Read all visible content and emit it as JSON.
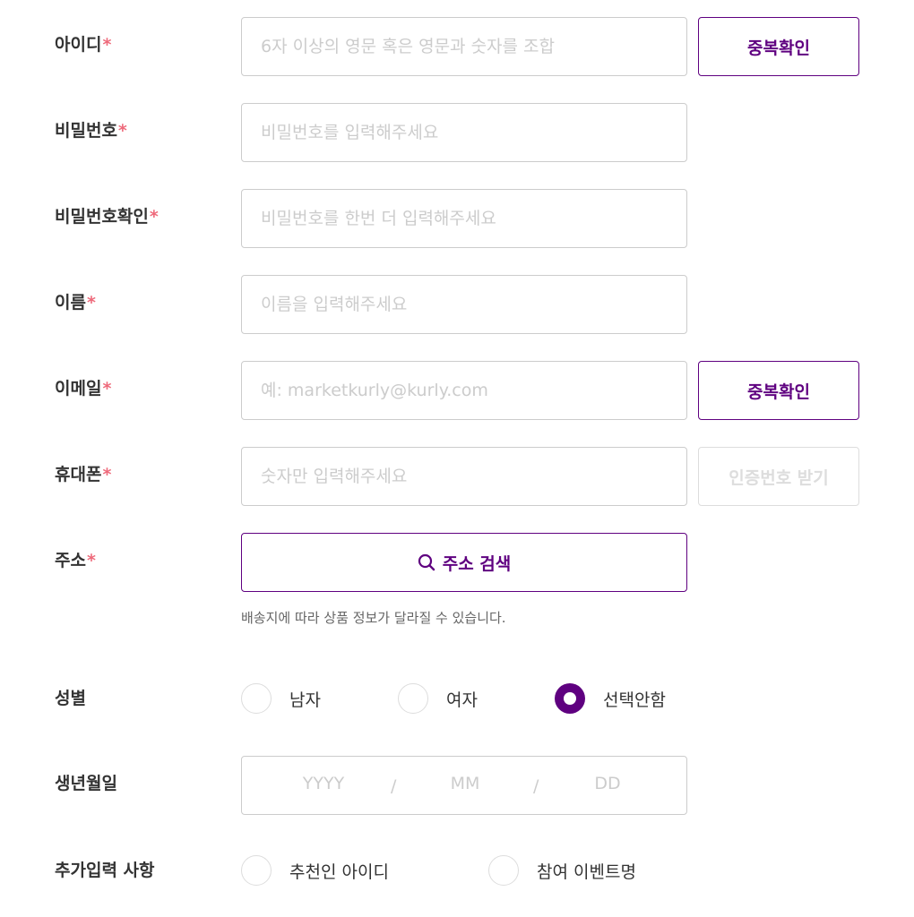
{
  "form": {
    "userid": {
      "label": "아이디",
      "required_mark": "*",
      "placeholder": "6자 이상의 영문 혹은 영문과 숫자를 조합",
      "check_button": "중복확인"
    },
    "password": {
      "label": "비밀번호",
      "required_mark": "*",
      "placeholder": "비밀번호를 입력해주세요"
    },
    "password_confirm": {
      "label": "비밀번호확인",
      "required_mark": "*",
      "placeholder": "비밀번호를 한번 더 입력해주세요"
    },
    "name": {
      "label": "이름",
      "required_mark": "*",
      "placeholder": "이름을 입력해주세요"
    },
    "email": {
      "label": "이메일",
      "required_mark": "*",
      "placeholder": "예: marketkurly@kurly.com",
      "check_button": "중복확인"
    },
    "phone": {
      "label": "휴대폰",
      "required_mark": "*",
      "placeholder": "숫자만 입력해주세요",
      "verify_button": "인증번호 받기"
    },
    "address": {
      "label": "주소",
      "required_mark": "*",
      "search_button": "주소 검색",
      "search_icon": "search-icon",
      "helper": "배송지에 따라 상품 정보가 달라질 수 있습니다."
    },
    "gender": {
      "label": "성별",
      "options": [
        "남자",
        "여자",
        "선택안함"
      ],
      "selected": "선택안함"
    },
    "birthdate": {
      "label": "생년월일",
      "year_placeholder": "YYYY",
      "month_placeholder": "MM",
      "day_placeholder": "DD",
      "separator": "/"
    },
    "extra": {
      "label": "추가입력 사항",
      "options": [
        "추천인 아이디",
        "참여 이벤트명"
      ]
    }
  },
  "colors": {
    "accent": "#5f0080",
    "required": "#ee6a7b",
    "border": "#cccccc",
    "placeholder": "#cccccc",
    "disabled": "#dddddd",
    "text": "#333333"
  }
}
